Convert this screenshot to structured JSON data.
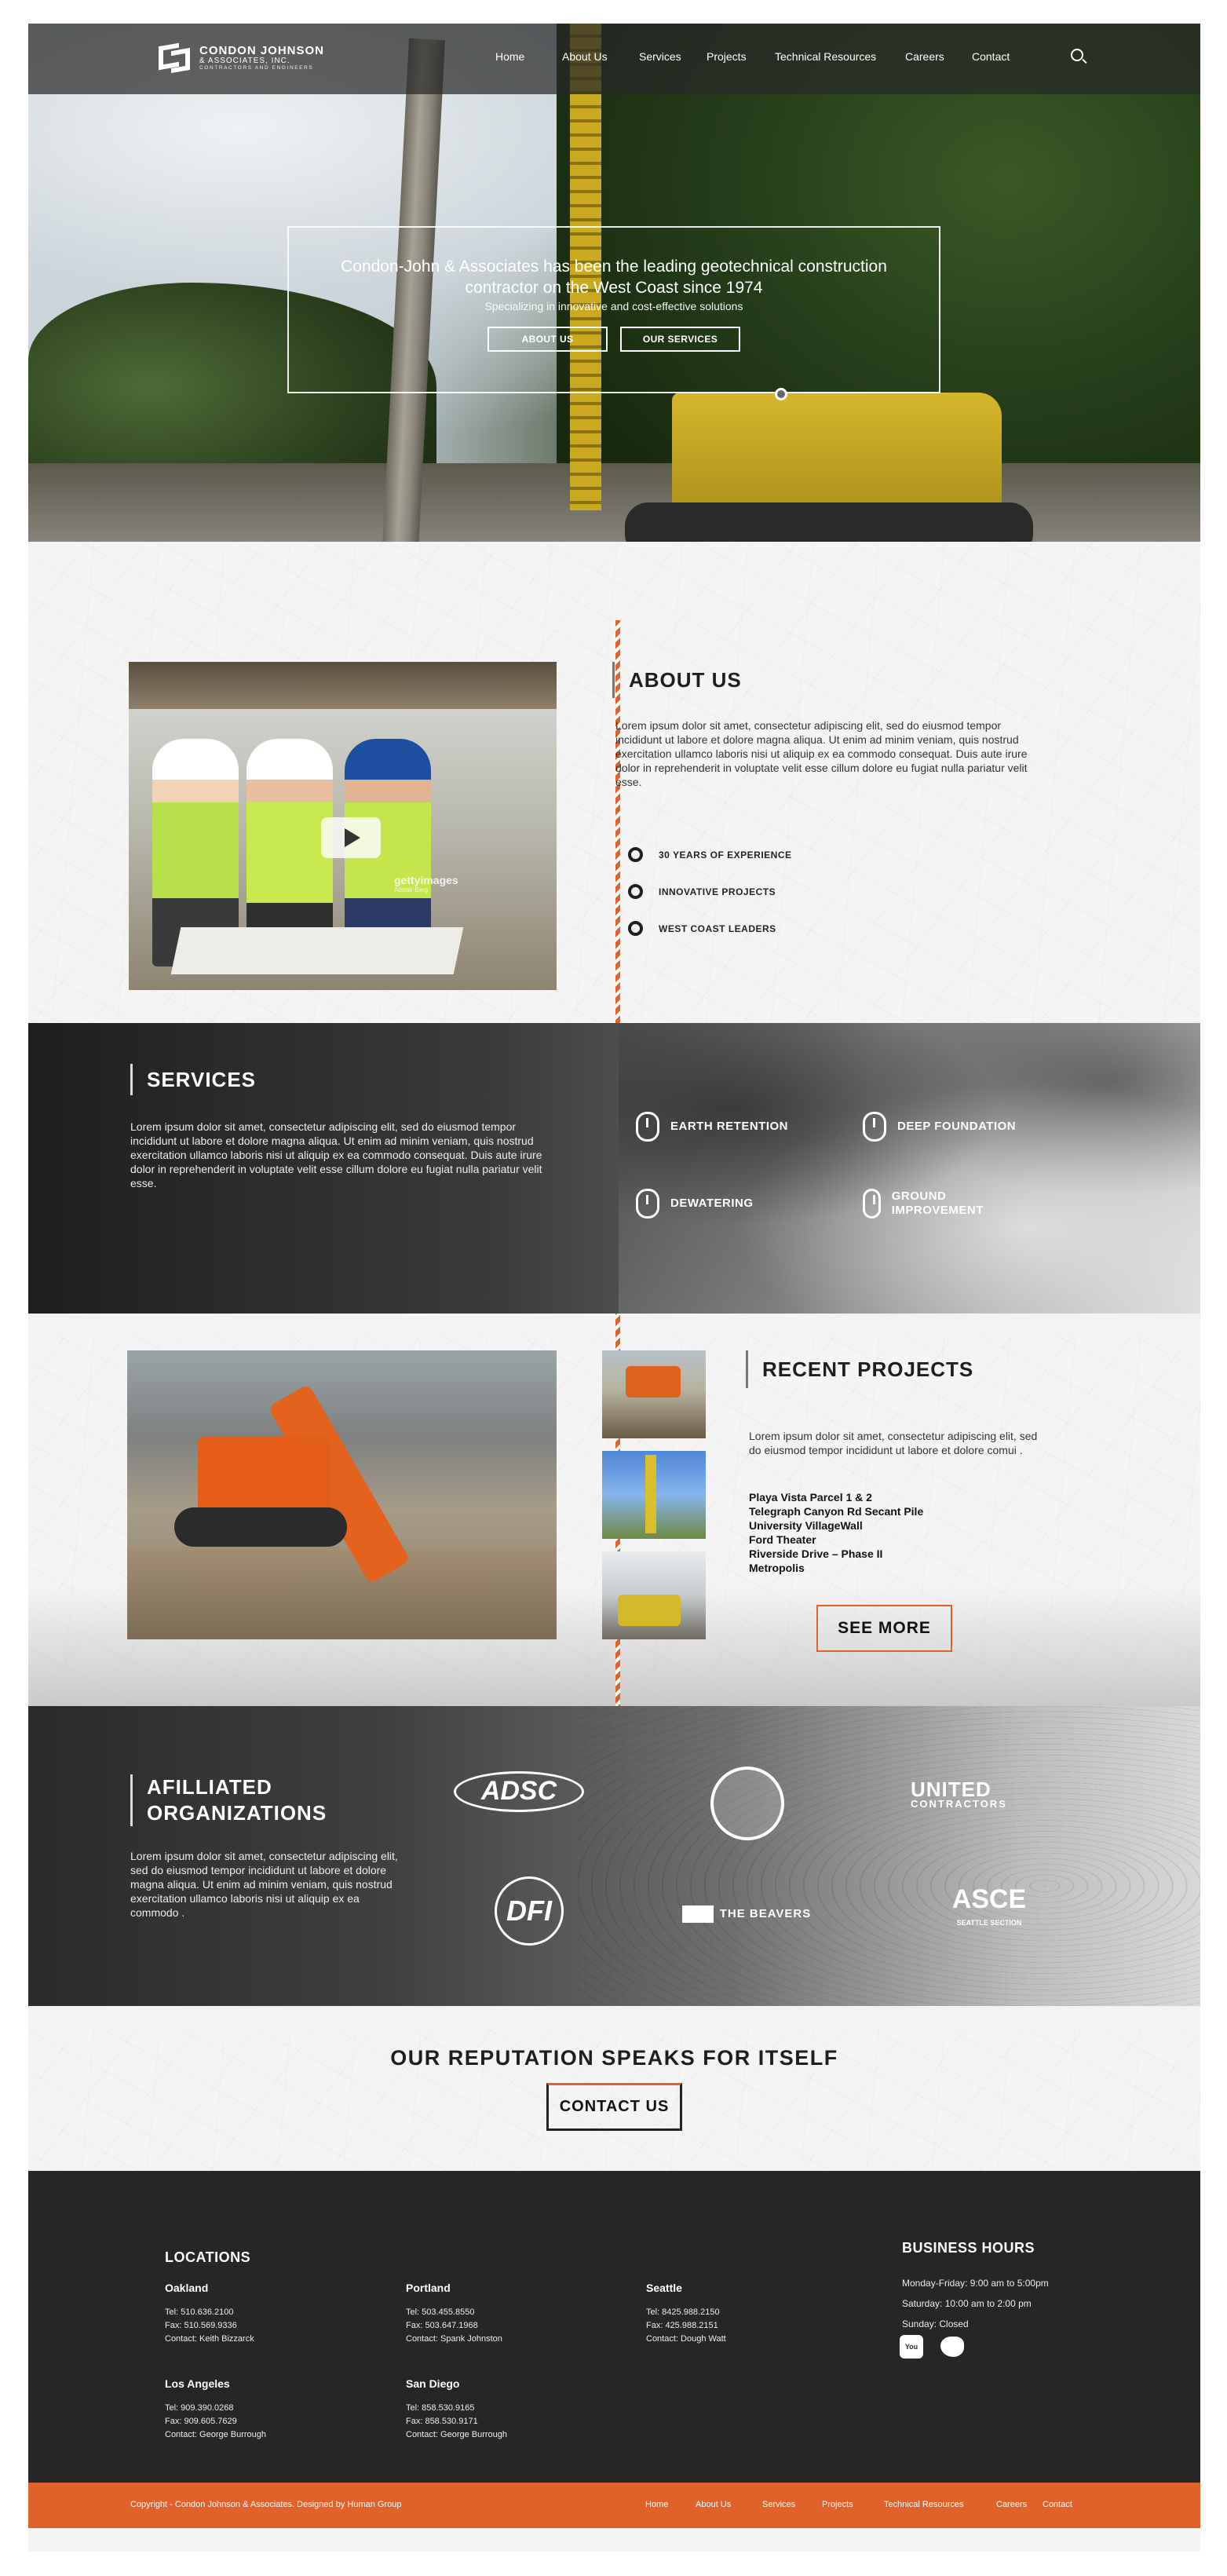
{
  "brand": {
    "name_line1": "CONDON JOHNSON",
    "name_line2": "& ASSOCIATES, INC.",
    "name_line3": "CONTRACTORS AND ENGINEERS"
  },
  "nav": {
    "items": [
      "Home",
      "About Us",
      "Services",
      "Projects",
      "Technical Resources",
      "Careers",
      "Contact"
    ],
    "search_icon": "search-icon"
  },
  "hero": {
    "headline": "Condon-John & Associates has been the leading geotechnical construction contractor on the West Coast since 1974",
    "subhead": "Specializing in innovative and cost-effective solutions",
    "about_button": "ABOUT US",
    "services_button": "OUR SERVICES"
  },
  "about": {
    "title": "ABOUT US",
    "body": "Lorem ipsum dolor sit amet, consectetur adipiscing elit, sed do eiusmod tempor incididunt ut labore et dolore magna aliqua. Ut enim ad minim veniam, quis nostrud exercitation ullamco laboris nisi ut aliquip ex ea commodo consequat. Duis aute irure dolor in reprehenderit in voluptate velit esse cillum dolore eu fugiat nulla pariatur velit esse.",
    "highlights": [
      "30 YEARS OF EXPERIENCE",
      "INNOVATIVE PROJECTS",
      "WEST COAST LEADERS"
    ],
    "video_watermark": "gettyimages",
    "video_credit": "Alistair Berg"
  },
  "services": {
    "title": "SERVICES",
    "body": "Lorem ipsum dolor sit amet, consectetur adipiscing elit, sed do eiusmod tempor incididunt ut labore et dolore magna aliqua. Ut enim ad minim veniam, quis nostrud exercitation ullamco laboris nisi ut aliquip ex ea commodo consequat. Duis aute irure dolor in reprehenderit in voluptate velit esse cillum dolore eu fugiat nulla pariatur velit esse.",
    "items": [
      "EARTH RETENTION",
      "DEEP FOUNDATION",
      "DEWATERING",
      "GROUND IMPROVEMENT"
    ]
  },
  "projects": {
    "title": "RECENT PROJECTS",
    "body": "Lorem ipsum dolor sit amet, consectetur adipiscing elit, sed do eiusmod tempor incididunt ut labore et dolore comui .",
    "list": [
      "Playa Vista Parcel 1 & 2",
      "Telegraph Canyon Rd Secant Pile",
      "University VillageWall",
      "Ford Theater",
      "Riverside Drive – Phase II",
      "Metropolis"
    ],
    "see_more": "SEE MORE"
  },
  "affiliated": {
    "title_line1": "AFILLIATED",
    "title_line2": "ORGANIZATIONS",
    "body": "Lorem ipsum dolor sit amet, consectetur adipiscing elit, sed do eiusmod tempor incididunt ut labore et dolore magna aliqua. Ut enim ad minim veniam, quis nostrud exercitation ullamco laboris nisi ut aliquip ex ea commodo .",
    "logos": {
      "adsc": "ADSC",
      "united": "UNITED",
      "united_sub": "CONTRACTORS",
      "dfi": "DFI",
      "beavers": "THE BEAVERS",
      "asce": "ASCE",
      "asce_sub": "SEATTLE SECTION"
    }
  },
  "reputation": {
    "title": "OUR REPUTATION SPEAKS FOR ITSELF",
    "button": "CONTACT US"
  },
  "footer": {
    "locations_title": "LOCATIONS",
    "locations": [
      {
        "city": "Oakland",
        "tel": "Tel: 510.636.2100",
        "fax": "Fax: 510.569.9336",
        "contact": "Contact: Keith Bizzarck"
      },
      {
        "city": "Portland",
        "tel": "Tel: 503.455.8550",
        "fax": "Fax: 503.647.1968",
        "contact": "Contact: Spank Johnston"
      },
      {
        "city": "Seattle",
        "tel": "Tel: 8425.988.2150",
        "fax": "Fax: 425.988.2151",
        "contact": "Contact: Dough Watt"
      },
      {
        "city": "Los Angeles",
        "tel": "Tel: 909.390.0268",
        "fax": "Fax: 909.605.7629",
        "contact": "Contact: George Burrough"
      },
      {
        "city": "San Diego",
        "tel": "Tel: 858.530.9165",
        "fax": "Fax: 858.530.9171",
        "contact": "Contact: George Burrough"
      }
    ],
    "hours_title": "BUSINESS HOURS",
    "hours": [
      "Monday-Friday: 9:00 am to 5:00pm",
      "Saturday: 10:00 am to 2:00 pm",
      "Sunday: Closed"
    ],
    "youtube_label": "You Tube",
    "copyright": "Copyright - Condon Johnson & Associates. Designed by Human Group",
    "bottom_nav": [
      "Home",
      "About Us",
      "Services",
      "Projects",
      "Technical Resources",
      "Careers",
      "Contact"
    ]
  },
  "colors": {
    "accent": "#e0622a",
    "dark": "#262626",
    "nav_bg": "rgba(40,40,40,0.72)"
  }
}
